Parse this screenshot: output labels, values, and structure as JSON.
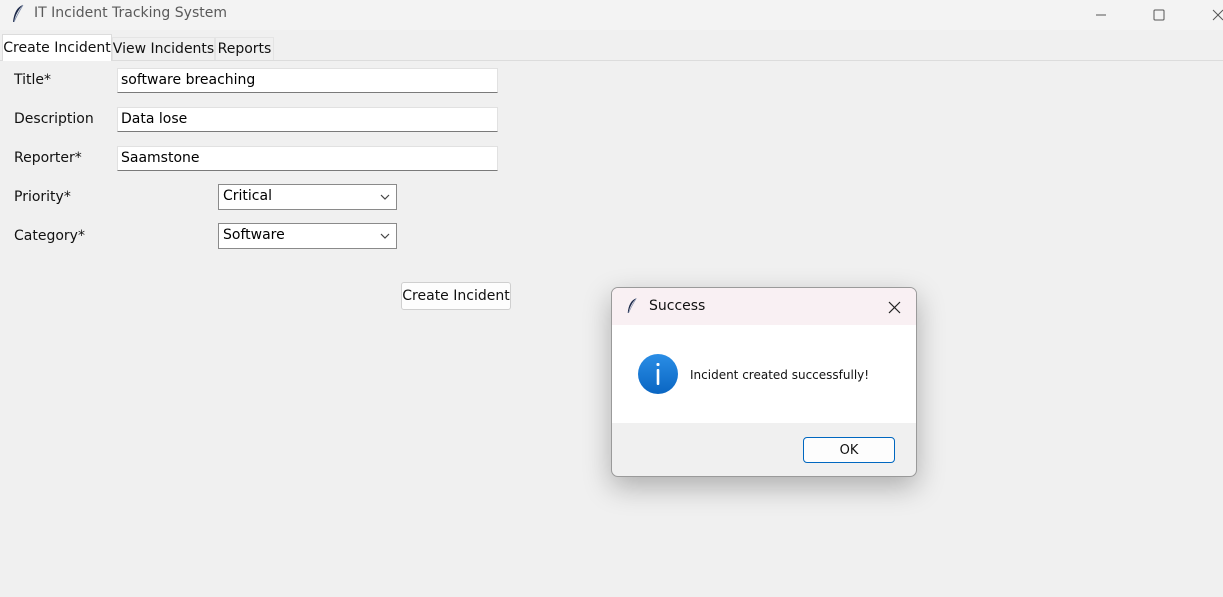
{
  "window": {
    "title": "IT Incident Tracking System",
    "icons": [
      "feather-icon",
      "minimize-icon",
      "maximize-icon",
      "close-icon"
    ]
  },
  "tabs": [
    {
      "label": "Create Incident",
      "active": true
    },
    {
      "label": "View Incidents",
      "active": false
    },
    {
      "label": "Reports",
      "active": false
    }
  ],
  "form": {
    "title_label": "Title*",
    "title_value": "software breaching",
    "description_label": "Description",
    "description_value": "Data lose",
    "reporter_label": "Reporter*",
    "reporter_value": "Saamstone",
    "priority_label": "Priority*",
    "priority_value": "Critical",
    "category_label": "Category*",
    "category_value": "Software",
    "submit_label": "Create Incident"
  },
  "dialog": {
    "title": "Success",
    "message": "Incident created successfully!",
    "ok_label": "OK",
    "icon": "info-icon",
    "accent_color": "#0067c0"
  }
}
